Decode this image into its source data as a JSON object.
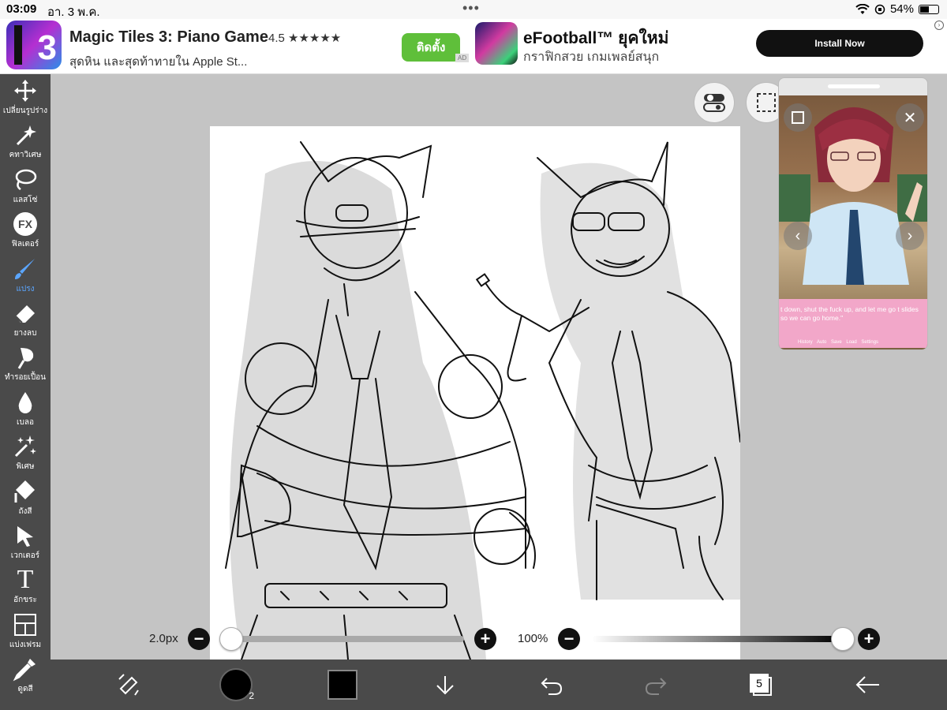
{
  "status_bar": {
    "time": "03:09",
    "date": "อา. 3 พ.ค.",
    "battery": "54%",
    "battery_level": 0.54
  },
  "ad_banner": {
    "ad1": {
      "title": "Magic Tiles 3: Piano Game",
      "rating": "4.5 ★★★★★",
      "subtitle": "สุดหิน และสุดท้าทายใน Apple St...",
      "button": "ติดตั้ง",
      "icon_text": "3"
    },
    "ad_tag": "AD",
    "ad2": {
      "title": "eFootball™ ยุคใหม่",
      "subtitle": "กราฟิกสวย เกมเพลย์สนุก",
      "button": "Install Now"
    }
  },
  "toolbar": {
    "items": [
      {
        "label": "เปลี่ยนรูปร่าง",
        "icon": "move-icon"
      },
      {
        "label": "คทาวิเศษ",
        "icon": "magic-wand-icon"
      },
      {
        "label": "แลสโซ่",
        "icon": "lasso-icon"
      },
      {
        "label": "ฟิลเตอร์",
        "icon": "fx-icon",
        "icon_text": "FX"
      },
      {
        "label": "แปรง",
        "icon": "brush-icon",
        "active": true
      },
      {
        "label": "ยางลบ",
        "icon": "eraser-icon"
      },
      {
        "label": "ทำรอยเปื้อน",
        "icon": "smudge-icon"
      },
      {
        "label": "เบลอ",
        "icon": "blur-icon"
      },
      {
        "label": "พิเศษ",
        "icon": "special-icon"
      },
      {
        "label": "ถังสี",
        "icon": "bucket-icon"
      },
      {
        "label": "เวกเตอร์",
        "icon": "vector-icon"
      },
      {
        "label": "อักขระ",
        "icon": "text-icon",
        "icon_text": "T"
      },
      {
        "label": "แบ่งเฟรม",
        "icon": "frame-divider-icon"
      },
      {
        "label": "ดูดสี",
        "icon": "eyedropper-icon"
      }
    ]
  },
  "pip": {
    "dialog_text": "t down, shut the fuck up, and let me go t slides so we can go home.\"",
    "menu": "History  Auto  Save  Load  Settings"
  },
  "sliders": {
    "brush_size_label": "2.0px",
    "brush_size_value": 0.0,
    "opacity_label": "100%",
    "opacity_value": 1.0
  },
  "bottom_bar": {
    "brush_size_badge": "2",
    "layers_count": "5"
  },
  "colors": {
    "toolbar_bg": "#4a4a4a",
    "active_tool": "#5ba6ff",
    "workspace_bg": "#c4c4c4",
    "install_green": "#5fbf3a"
  }
}
